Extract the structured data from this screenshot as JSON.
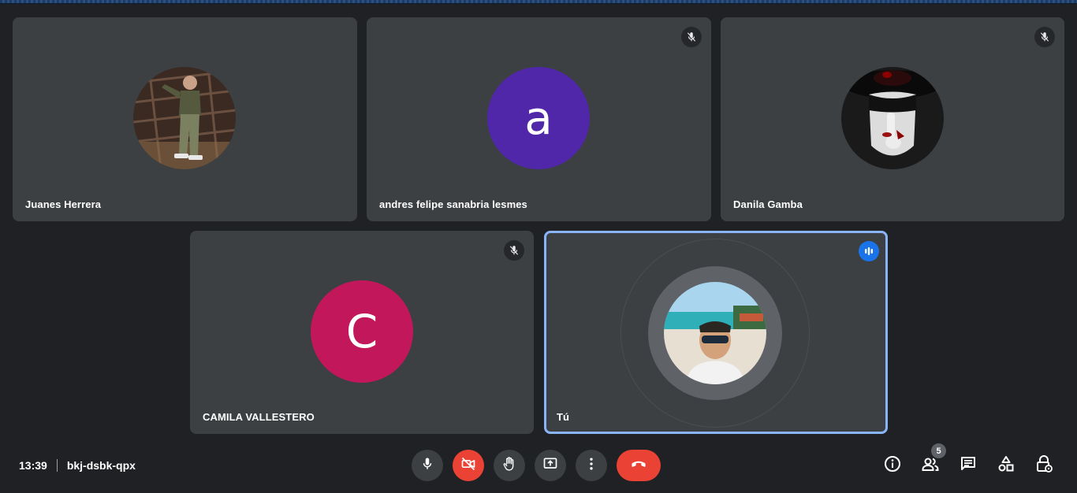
{
  "meeting": {
    "time": "13:39",
    "code": "bkj-dsbk-qpx"
  },
  "participants": [
    {
      "name": "Juanes Herrera",
      "avatar": "photo",
      "muted": false
    },
    {
      "name": "andres felipe sanabria lesmes",
      "avatar_letter": "a",
      "avatar_color": "#5027a9",
      "muted": true
    },
    {
      "name": "Danila Gamba",
      "avatar": "photo",
      "muted": true
    },
    {
      "name": "CAMILA VALLESTERO",
      "avatar_letter": "C",
      "avatar_color": "#c2185b",
      "muted": true
    },
    {
      "name": "Tú",
      "avatar": "photo",
      "muted": false,
      "speaking": true,
      "is_self": true
    }
  ],
  "controls": {
    "items": [
      "microphone-icon",
      "camera-off-icon",
      "raise-hand-icon",
      "present-screen-icon",
      "more-options-icon",
      "hang-up-icon"
    ],
    "camera_off_color": "#ea4335",
    "hangup_color": "#ea4335"
  },
  "side_controls": {
    "items": [
      "info-icon",
      "people-icon",
      "chat-icon",
      "activities-icon",
      "host-controls-icon"
    ],
    "people_count": "5"
  },
  "colors": {
    "background": "#202124",
    "tile": "#3c4043",
    "active_border": "#8ab4f8",
    "speaking_badge": "#1a73e8"
  }
}
